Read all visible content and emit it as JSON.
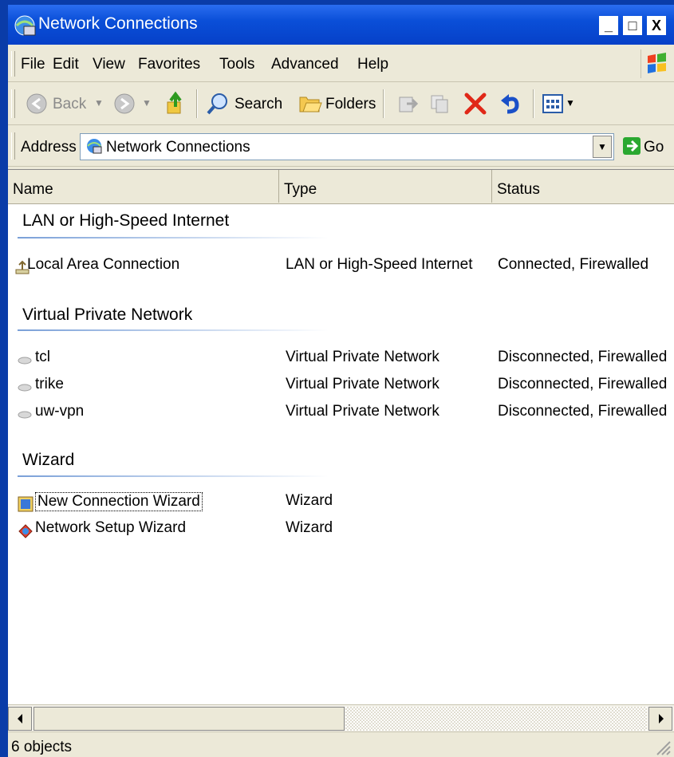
{
  "window": {
    "title": "Network Connections"
  },
  "caption_buttons": {
    "minimize": "_",
    "maximize": "□",
    "close": "X"
  },
  "menu": [
    "File",
    "Edit",
    "View",
    "Favorites",
    "Tools",
    "Advanced",
    "Help"
  ],
  "toolbar": {
    "back_label": "Back",
    "search_label": "Search",
    "folders_label": "Folders"
  },
  "address": {
    "label": "Address",
    "value": "Network Connections",
    "go_label": "Go"
  },
  "columns": [
    "Name",
    "Type",
    "Status"
  ],
  "groups": [
    {
      "title": "LAN or High-Speed Internet",
      "items": [
        {
          "name": "Local Area Connection",
          "type": "LAN or High-Speed Internet",
          "status": "Connected, Firewalled",
          "icon": "network-cable-icon"
        }
      ]
    },
    {
      "title": "Virtual Private Network",
      "items": [
        {
          "name": "tcl",
          "type": "Virtual Private Network",
          "status": "Disconnected, Firewalled",
          "icon": "vpn-icon"
        },
        {
          "name": "trike",
          "type": "Virtual Private Network",
          "status": "Disconnected, Firewalled",
          "icon": "vpn-icon"
        },
        {
          "name": "uw-vpn",
          "type": "Virtual Private Network",
          "status": "Disconnected, Firewalled",
          "icon": "vpn-icon"
        }
      ]
    },
    {
      "title": "Wizard",
      "items": [
        {
          "name": "New Connection Wizard",
          "type": "Wizard",
          "status": "",
          "icon": "wizard-icon"
        },
        {
          "name": "Network Setup Wizard",
          "type": "Wizard",
          "status": "",
          "icon": "setup-wizard-icon"
        }
      ]
    }
  ],
  "status_bar": {
    "text": "6 objects"
  },
  "colors": {
    "titlebar": "#0a4fd8",
    "desktop": "#0a3ca8",
    "chrome": "#ece9d8"
  }
}
